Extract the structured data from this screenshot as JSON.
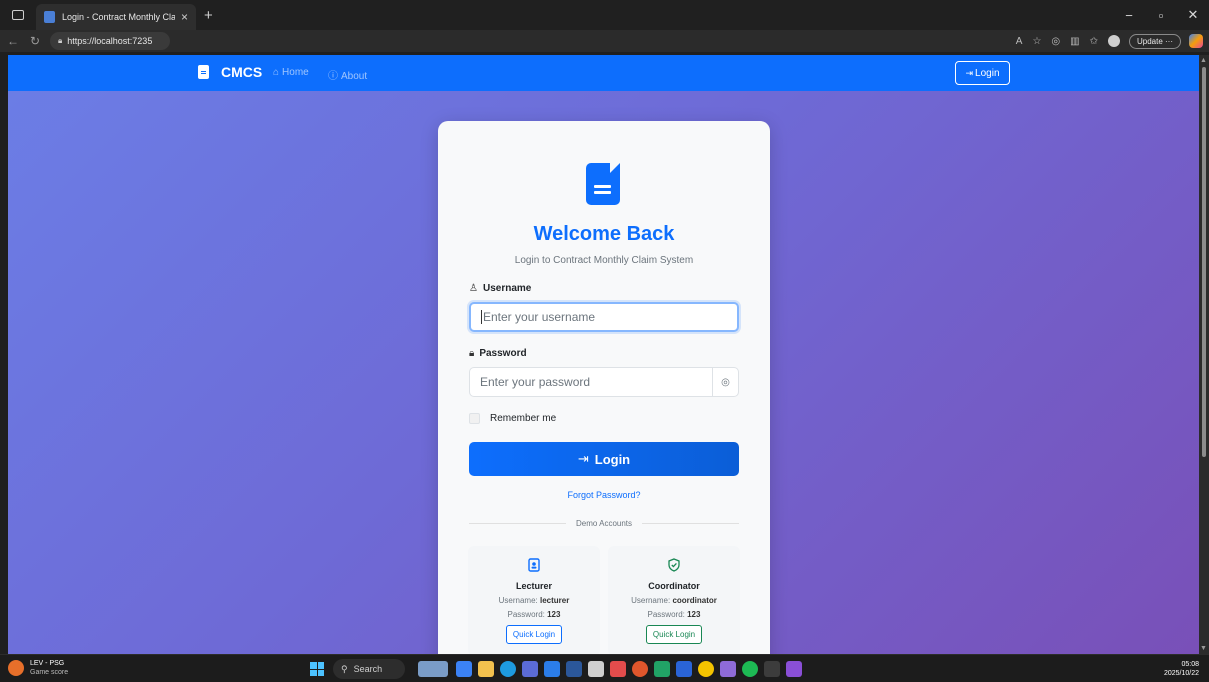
{
  "browser": {
    "tab_title": "Login - Contract Monthly Claim S",
    "url": "https://localhost:7235",
    "update_label": "Update"
  },
  "navbar": {
    "brand": "CMCS",
    "home": "Home",
    "about": "About",
    "login": "Login"
  },
  "login_card": {
    "heading": "Welcome Back",
    "subtitle": "Login to Contract Monthly Claim System",
    "username_label": "Username",
    "username_placeholder": "Enter your username",
    "password_label": "Password",
    "password_placeholder": "Enter your password",
    "remember_label": "Remember me",
    "submit_label": "Login",
    "forgot_label": "Forgot Password?",
    "divider_label": "Demo Accounts"
  },
  "demo_accounts": [
    {
      "role": "Lecturer",
      "username_prefix": "Username:",
      "username": "lecturer",
      "password_prefix": "Password:",
      "password": "123",
      "button": "Quick Login",
      "color": "#0d6efd"
    },
    {
      "role": "Coordinator",
      "username_prefix": "Username:",
      "username": "coordinator",
      "password_prefix": "Password:",
      "password": "123",
      "button": "Quick Login",
      "color": "#198754"
    }
  ],
  "taskbar": {
    "widget_title": "LEV - PSG",
    "widget_sub": "Game score",
    "search_label": "Search",
    "time": "05:08",
    "date": "2025/10/22"
  },
  "colors": {
    "primary": "#0d6efd",
    "success": "#198754",
    "gradient_start": "#6b7ee6",
    "gradient_end": "#7950b8"
  }
}
